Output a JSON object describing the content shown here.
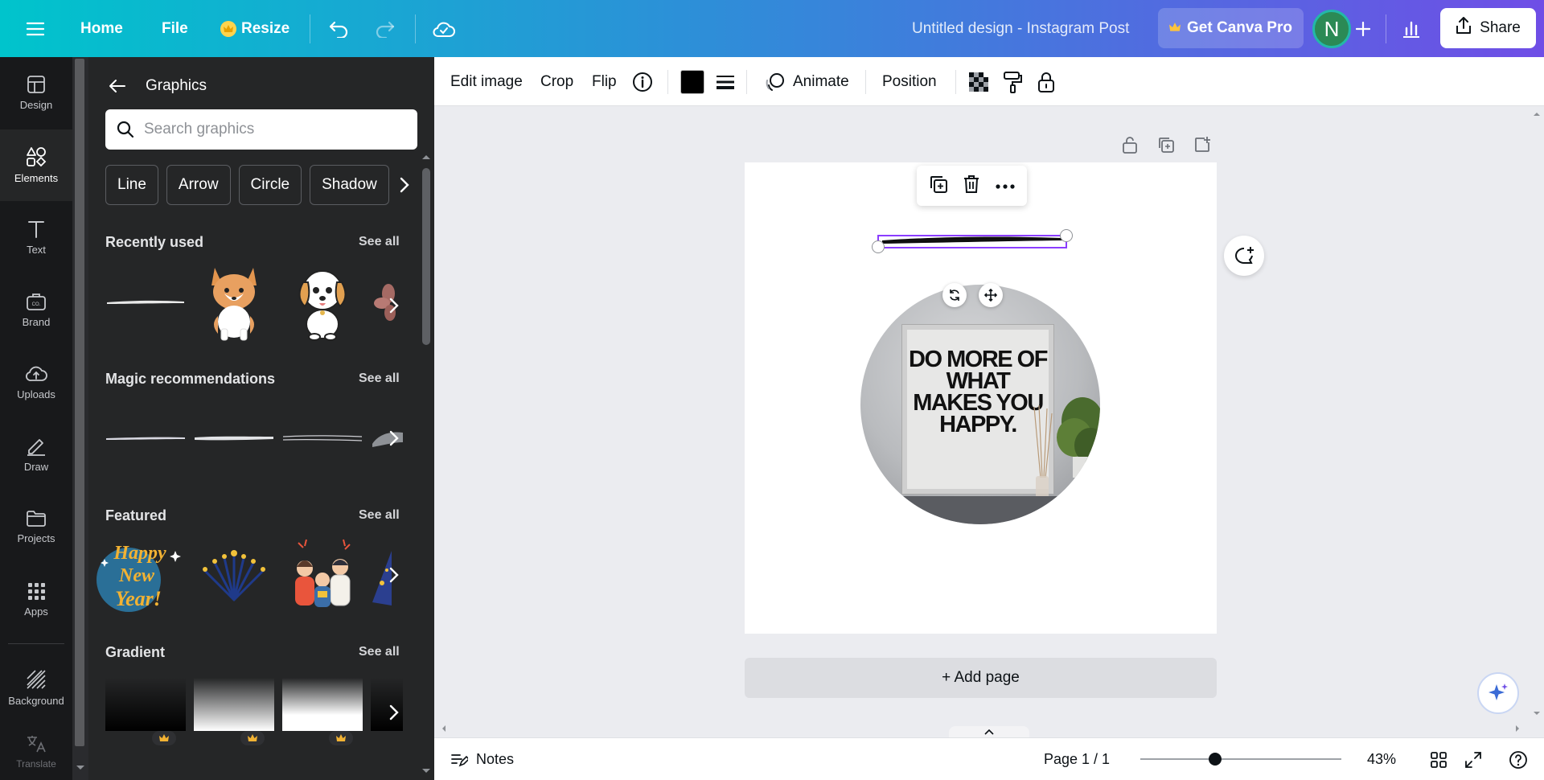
{
  "topbar": {
    "home": "Home",
    "file": "File",
    "resize": "Resize",
    "title": "Untitled design - Instagram Post",
    "get_pro": "Get Canva Pro",
    "avatar_initial": "N",
    "share": "Share"
  },
  "rail": {
    "items": [
      {
        "label": "Design",
        "icon": "design-icon"
      },
      {
        "label": "Elements",
        "icon": "elements-icon"
      },
      {
        "label": "Text",
        "icon": "text-icon"
      },
      {
        "label": "Brand",
        "icon": "brand-icon"
      },
      {
        "label": "Uploads",
        "icon": "uploads-icon"
      },
      {
        "label": "Draw",
        "icon": "draw-icon"
      },
      {
        "label": "Projects",
        "icon": "projects-icon"
      },
      {
        "label": "Apps",
        "icon": "apps-icon"
      },
      {
        "label": "Background",
        "icon": "background-icon"
      },
      {
        "label": "Translate",
        "icon": "translate-icon"
      }
    ],
    "active": "Elements"
  },
  "panel": {
    "title": "Graphics",
    "search_placeholder": "Search graphics",
    "chips": [
      "Line",
      "Arrow",
      "Circle",
      "Shadow"
    ],
    "sections": {
      "recent": {
        "title": "Recently used",
        "see_all": "See all"
      },
      "magic": {
        "title": "Magic recommendations",
        "see_all": "See all"
      },
      "featured": {
        "title": "Featured",
        "see_all": "See all"
      },
      "gradient": {
        "title": "Gradient",
        "see_all": "See all"
      }
    }
  },
  "toolbar": {
    "edit_image": "Edit image",
    "crop": "Crop",
    "flip": "Flip",
    "animate": "Animate",
    "position": "Position",
    "color": "#000000"
  },
  "canvas": {
    "poster_text": "DO MORE OF WHAT MAKES YOU HAPPY.",
    "add_page": "+ Add page"
  },
  "bottombar": {
    "notes": "Notes",
    "page_indicator": "Page 1 / 1",
    "zoom": "43%",
    "zoom_fraction": 0.43
  },
  "colors": {
    "accent_purple": "#8b3dff",
    "brand_teal": "#00c4cc",
    "brand_violet": "#6f4ee6"
  }
}
